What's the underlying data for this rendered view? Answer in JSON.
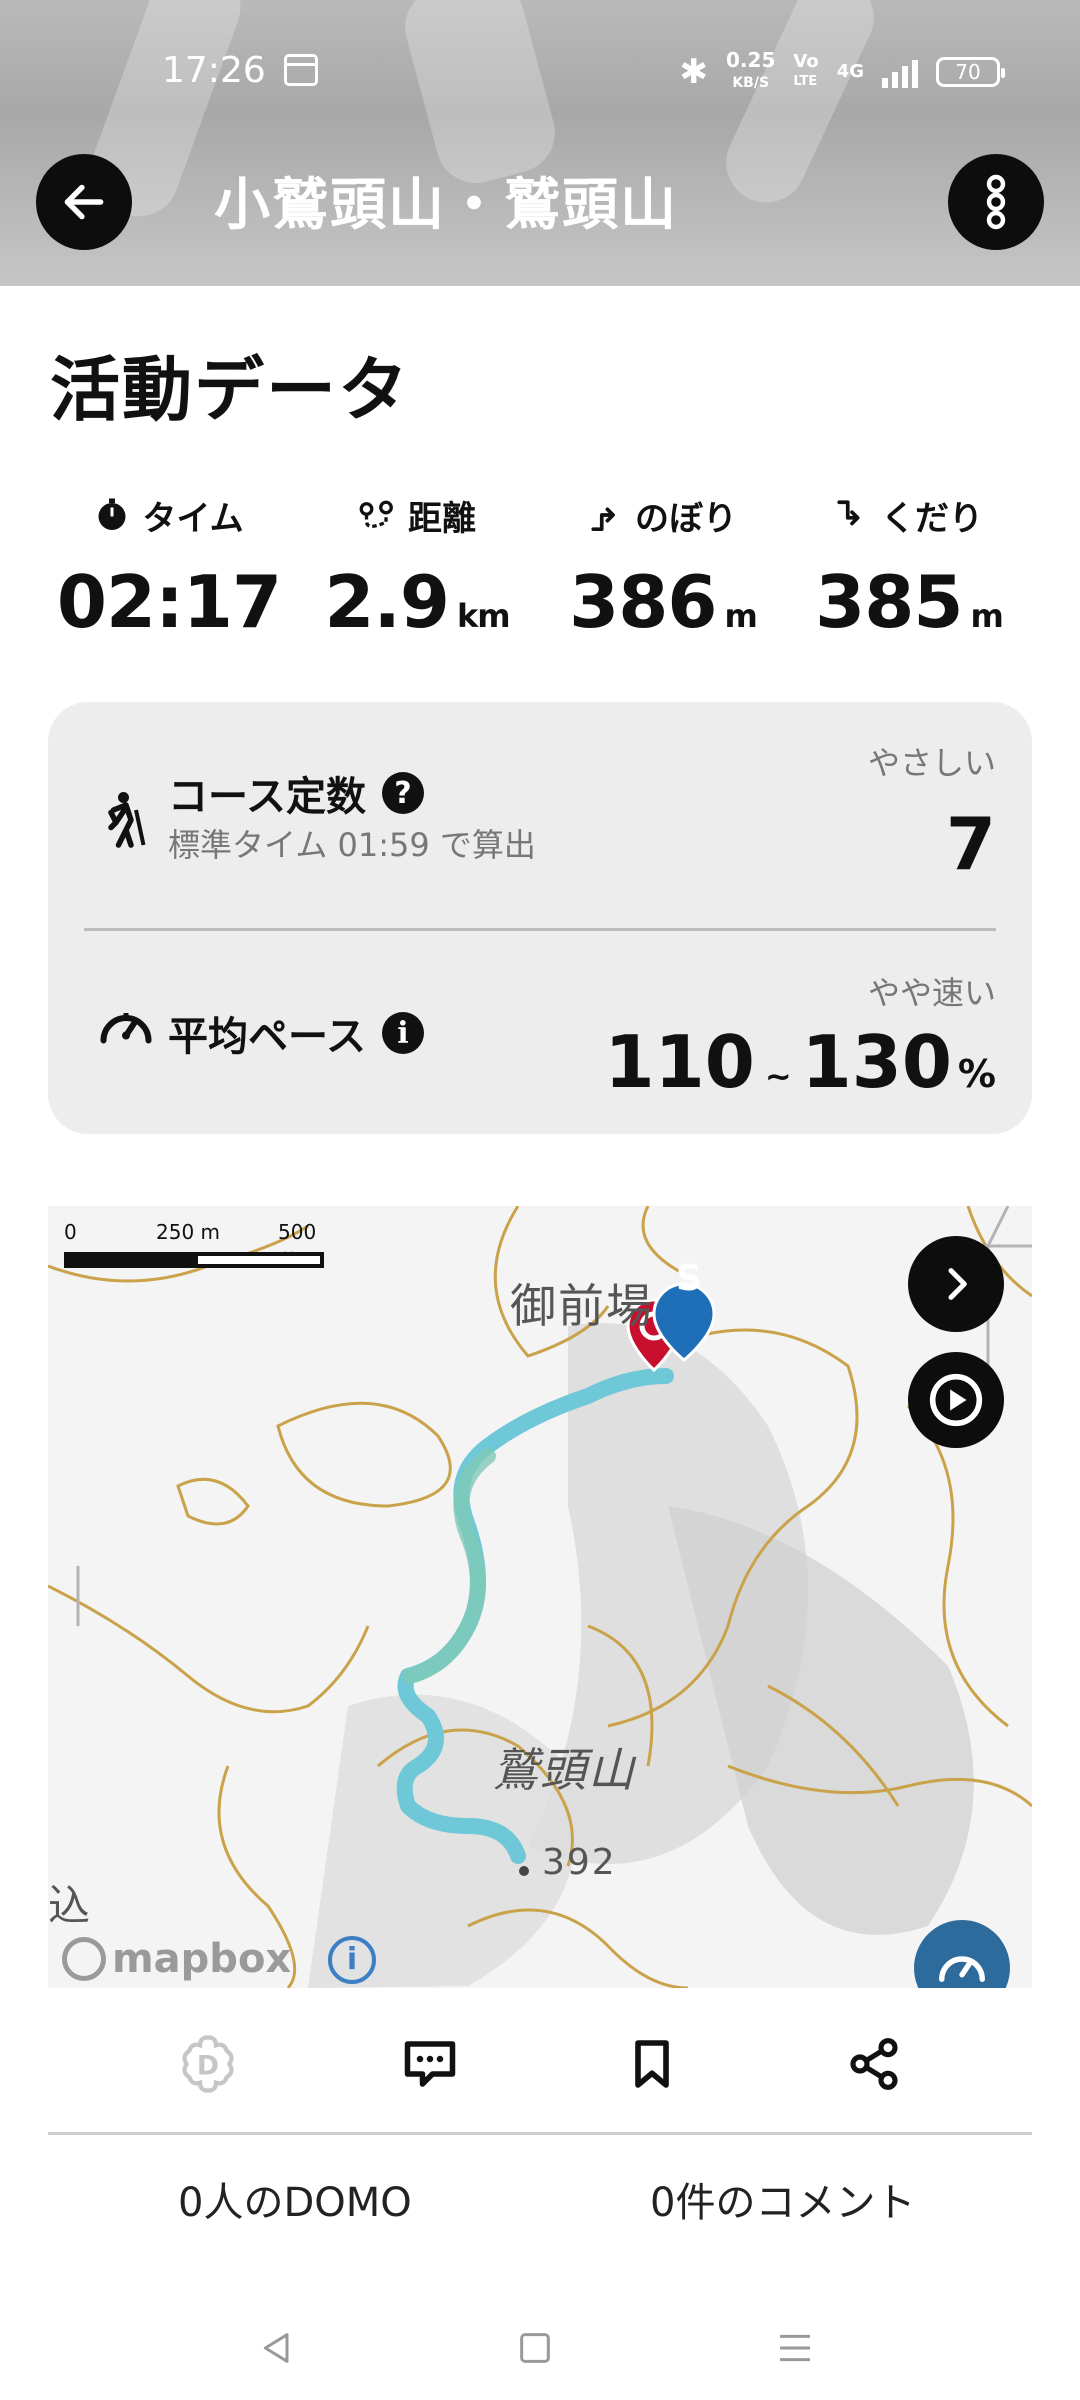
{
  "status_bar": {
    "time": "17:26",
    "net_speed_value": "0.25",
    "net_speed_unit": "KB/S",
    "volte_top": "Vo",
    "volte_bottom": "LTE",
    "network": "4G",
    "battery": "70"
  },
  "header": {
    "title": "小鷲頭山・鷲頭山"
  },
  "activity": {
    "section_title": "活動データ",
    "stats": {
      "time": {
        "label": "タイム",
        "value": "02:17",
        "unit": ""
      },
      "distance": {
        "label": "距離",
        "value": "2.9",
        "unit": "km"
      },
      "ascent": {
        "label": "のぼり",
        "value": "386",
        "unit": "m"
      },
      "descent": {
        "label": "くだり",
        "value": "385",
        "unit": "m"
      }
    }
  },
  "course_card": {
    "course_constant_label": "コース定数",
    "course_constant_sub": "標準タイム 01:59 で算出",
    "course_constant_level": "やさしい",
    "course_constant_value": "7",
    "pace_label": "平均ペース",
    "pace_level": "やや速い",
    "pace_min": "110",
    "pace_tilde": "~",
    "pace_max": "130",
    "pace_unit": "%"
  },
  "map": {
    "scale_0": "0",
    "scale_250": "250 m",
    "scale_500": "500 m",
    "place_label_1": "御前場",
    "place_label_2": "鷲頭山",
    "elevation_label": "392",
    "edge_label": "込",
    "start_marker": "S",
    "attribution": "mapbox",
    "route_color": "#6fc8d8",
    "goal_marker_color": "#c8102e",
    "start_marker_color": "#1f6fb8"
  },
  "footer": {
    "domo_count": "0人のDOMO",
    "comment_count": "0件のコメント"
  },
  "icons": {
    "back": "arrow-left-icon",
    "more": "more-vertical-icon",
    "domo": "domo-flower-icon",
    "comment": "comment-icon",
    "bookmark": "bookmark-icon",
    "share": "share-icon"
  }
}
